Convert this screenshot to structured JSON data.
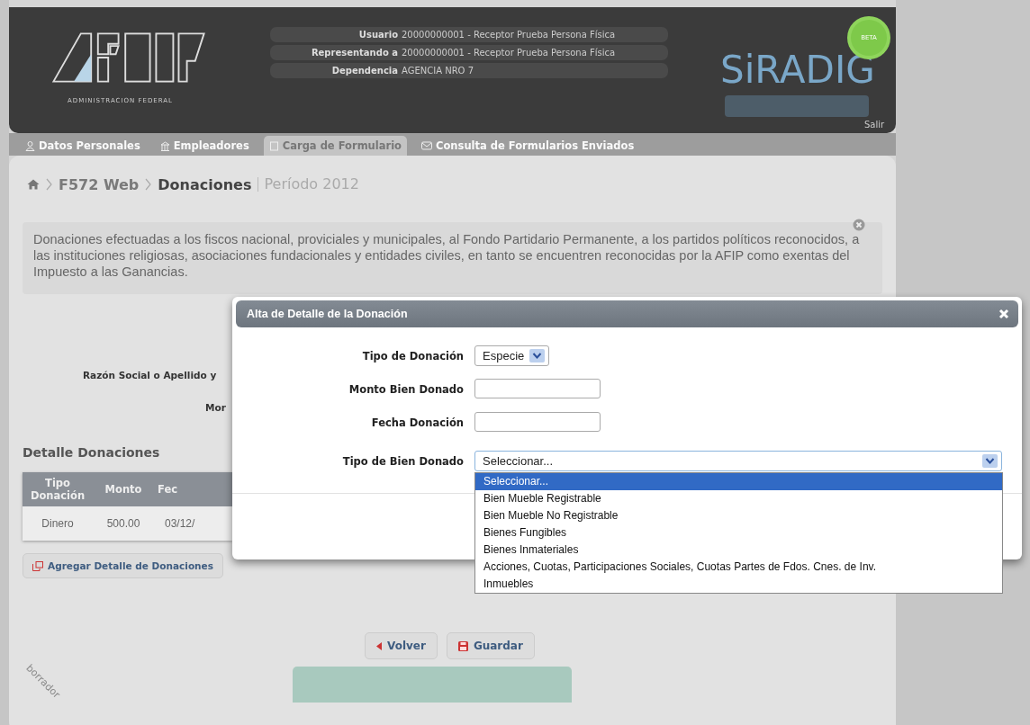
{
  "header": {
    "logo_subtitle": "ADMINISTRACION FEDERAL",
    "user_info": [
      {
        "label": "Usuario",
        "value": "20000000001 - Receptor Prueba Persona Física"
      },
      {
        "label": "Representando a",
        "value": "20000000001 - Receptor Prueba Persona Física"
      },
      {
        "label": "Dependencia",
        "value": "AGENCIA NRO 7"
      }
    ],
    "brand": "SiRADIG",
    "badge": "BETA",
    "logout": "Salir"
  },
  "nav_tabs": [
    {
      "label": "Datos Personales",
      "kind": "person",
      "selected": false
    },
    {
      "label": "Empleadores",
      "kind": "building",
      "selected": false
    },
    {
      "label": "Carga de Formulario",
      "kind": "document",
      "selected": true
    },
    {
      "label": "Consulta de Formularios Enviados",
      "kind": "envelope",
      "selected": false
    }
  ],
  "breadcrumb": [
    "F572 Web",
    "Donaciones"
  ],
  "period": "Período 2012",
  "description": "Donaciones efectuadas a los fiscos nacional, proviciales y municipales, al Fondo Partidario Permanente, a los partidos políticos reconocidos, a las instituciones religiosas, asociaciones fundacionales y entidades civiles, en tanto se encuentren reconocidas por la AFIP como exentas del Impuesto a las Ganancias.",
  "form_labels": [
    "Razón Social o Apellido y",
    "Mor"
  ],
  "detail": {
    "title": "Detalle Donaciones",
    "columns": [
      "Tipo Donación",
      "Monto",
      "Fec"
    ],
    "rows": [
      [
        "Dinero",
        "500.00",
        "03/12/"
      ]
    ],
    "add_button": "Agregar Detalle de Donaciones"
  },
  "actions": [
    {
      "label": "Volver",
      "kind": "back"
    },
    {
      "label": "Guardar",
      "kind": "save"
    }
  ],
  "draft_mark": "borrador",
  "modal": {
    "title": "Alta de Detalle de la Donación",
    "fields": [
      {
        "label": "Tipo de Donación",
        "kind": "select",
        "value": "Especie"
      },
      {
        "label": "Monto Bien Donado",
        "kind": "text"
      },
      {
        "label": "Fecha Donación",
        "kind": "text"
      },
      {
        "label": "Tipo de Bien Donado",
        "kind": "wide_select",
        "value": "Seleccionar..."
      }
    ],
    "options": [
      {
        "label": "Seleccionar...",
        "selected": true
      },
      {
        "label": "Bien Mueble Registrable",
        "selected": false
      },
      {
        "label": "Bien Mueble No Registrable",
        "selected": false
      },
      {
        "label": "Bienes Fungibles",
        "selected": false
      },
      {
        "label": "Bienes Inmateriales",
        "selected": false
      },
      {
        "label": "Acciones, Cuotas, Participaciones Sociales, Cuotas Partes de Fdos. Cnes. de Inv.",
        "selected": false
      },
      {
        "label": "Inmuebles",
        "selected": false
      }
    ]
  }
}
